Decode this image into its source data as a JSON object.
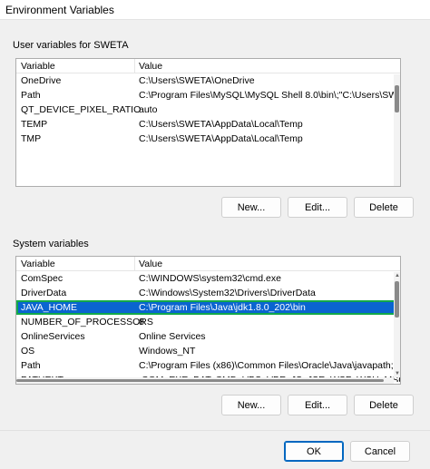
{
  "window": {
    "title": "Environment Variables"
  },
  "user_section": {
    "label": "User variables for SWETA",
    "columns": [
      "Variable",
      "Value"
    ],
    "rows": [
      {
        "variable": "OneDrive",
        "value": "C:\\Users\\SWETA\\OneDrive"
      },
      {
        "variable": "Path",
        "value": "C:\\Program Files\\MySQL\\MySQL Shell 8.0\\bin\\;\"C:\\Users\\SWETA\\Ap..."
      },
      {
        "variable": "QT_DEVICE_PIXEL_RATIO",
        "value": "auto"
      },
      {
        "variable": "TEMP",
        "value": "C:\\Users\\SWETA\\AppData\\Local\\Temp"
      },
      {
        "variable": "TMP",
        "value": "C:\\Users\\SWETA\\AppData\\Local\\Temp"
      }
    ],
    "buttons": {
      "new": "New...",
      "edit": "Edit...",
      "delete": "Delete"
    }
  },
  "system_section": {
    "label": "System variables",
    "columns": [
      "Variable",
      "Value"
    ],
    "rows": [
      {
        "variable": "ComSpec",
        "value": "C:\\WINDOWS\\system32\\cmd.exe"
      },
      {
        "variable": "DriverData",
        "value": "C:\\Windows\\System32\\Drivers\\DriverData"
      },
      {
        "variable": "JAVA_HOME",
        "value": "C:\\Program Files\\Java\\jdk1.8.0_202\\bin"
      },
      {
        "variable": "NUMBER_OF_PROCESSORS",
        "value": "8"
      },
      {
        "variable": "OnlineServices",
        "value": "Online Services"
      },
      {
        "variable": "OS",
        "value": "Windows_NT"
      },
      {
        "variable": "Path",
        "value": "C:\\Program Files (x86)\\Common Files\\Oracle\\Java\\javapath;C:\\or..."
      },
      {
        "variable": "PATHEXT",
        "value": ".COM;.EXE;.BAT;.CMD;.VBS;.VBE;.JS;.JSE;.WSF;.WSH;.MSC"
      }
    ],
    "selected_variable": "JAVA_HOME",
    "buttons": {
      "new": "New...",
      "edit": "Edit...",
      "delete": "Delete"
    }
  },
  "dialog_buttons": {
    "ok": "OK",
    "cancel": "Cancel"
  },
  "colors": {
    "selection": "#0a64d0",
    "selection_outline": "#12a84a",
    "primary_border": "#0067c0"
  }
}
